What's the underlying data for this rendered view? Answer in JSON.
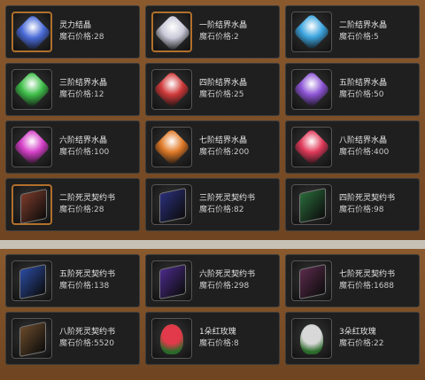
{
  "price_label": "魔石价格:",
  "top_items": [
    {
      "name": "灵力结晶",
      "price": "28",
      "icon": "spirit-crystal-icon",
      "color": "#4a6bd8",
      "kind": "gem",
      "framed": true
    },
    {
      "name": "一阶结界水晶",
      "price": "2",
      "icon": "barrier-crystal-1-icon",
      "color": "#c9c9d8",
      "kind": "gem",
      "framed": true
    },
    {
      "name": "二阶结界水晶",
      "price": "5",
      "icon": "barrier-crystal-2-icon",
      "color": "#3da6e0",
      "kind": "gem",
      "framed": false
    },
    {
      "name": "三阶结界水晶",
      "price": "12",
      "icon": "barrier-crystal-3-icon",
      "color": "#3fbf4a",
      "kind": "gem",
      "framed": false
    },
    {
      "name": "四阶结界水晶",
      "price": "25",
      "icon": "barrier-crystal-4-icon",
      "color": "#d03a3a",
      "kind": "gem",
      "framed": false
    },
    {
      "name": "五阶结界水晶",
      "price": "50",
      "icon": "barrier-crystal-5-icon",
      "color": "#8d55d6",
      "kind": "gem",
      "framed": false
    },
    {
      "name": "六阶结界水晶",
      "price": "100",
      "icon": "barrier-crystal-6-icon",
      "color": "#d540c8",
      "kind": "gem",
      "framed": false
    },
    {
      "name": "七阶结界水晶",
      "price": "200",
      "icon": "barrier-crystal-7-icon",
      "color": "#e07a28",
      "kind": "gem",
      "framed": false
    },
    {
      "name": "八阶结界水晶",
      "price": "400",
      "icon": "barrier-crystal-8-icon",
      "color": "#e03a5a",
      "kind": "gem",
      "framed": false
    },
    {
      "name": "二阶死灵契约书",
      "price": "28",
      "icon": "necro-contract-2-icon",
      "color": "#7a3a2a",
      "kind": "book",
      "framed": true
    },
    {
      "name": "三阶死灵契约书",
      "price": "82",
      "icon": "necro-contract-3-icon",
      "color": "#2a2f7a",
      "kind": "book",
      "framed": false
    },
    {
      "name": "四阶死灵契约书",
      "price": "98",
      "icon": "necro-contract-4-icon",
      "color": "#2a6a3a",
      "kind": "book",
      "framed": false
    }
  ],
  "bottom_items": [
    {
      "name": "五阶死灵契约书",
      "price": "138",
      "icon": "necro-contract-5-icon",
      "color": "#2a4aa0",
      "kind": "book",
      "framed": false
    },
    {
      "name": "六阶死灵契约书",
      "price": "298",
      "icon": "necro-contract-6-icon",
      "color": "#4a2a8a",
      "kind": "book",
      "framed": false
    },
    {
      "name": "七阶死灵契约书",
      "price": "1688",
      "icon": "necro-contract-7-icon",
      "color": "#5a2a4a",
      "kind": "book",
      "framed": false
    },
    {
      "name": "八阶死灵契约书",
      "price": "5520",
      "icon": "necro-contract-8-icon",
      "color": "#6a4a2a",
      "kind": "book",
      "framed": false
    },
    {
      "name": "1朵红玫瑰",
      "price": "8",
      "icon": "red-rose-icon",
      "color": "#e23a4a",
      "kind": "flower",
      "framed": false
    },
    {
      "name": "3朵红玫瑰",
      "price": "22",
      "icon": "red-rose-bouquet-icon",
      "color": "#d8d8d8",
      "kind": "flower",
      "framed": false
    }
  ]
}
